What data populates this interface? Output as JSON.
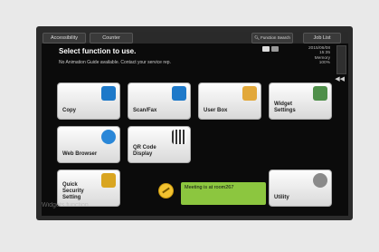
{
  "topbar": {
    "accessibility_label": "Accessibility",
    "counter_label": "Counter",
    "search_label": "Function Search",
    "joblist_label": "Job List"
  },
  "header": {
    "title": "Select function to use.",
    "subtitle": "No Animation Guide available. Contact your service rep.",
    "date": "2015/06/08",
    "time": "15:35",
    "memory_label": "Memory",
    "memory_value": "100%"
  },
  "tiles": {
    "copy": "Copy",
    "scan_fax": "Scan/Fax",
    "user_box": "User Box",
    "widget_settings": "Widget Settings",
    "web_browser": "Web Browser",
    "qr_code_display": "QR Code Display",
    "quick_security": "Quick Security Setting",
    "utility": "Utility"
  },
  "widget": {
    "meeting_text": "Meeting is at room267"
  },
  "watermark": "Widgets function",
  "colors": {
    "screen_bg": "#0b0b0b",
    "tile_bg": "#f4f4f4",
    "widget_green": "#8cc63f"
  }
}
